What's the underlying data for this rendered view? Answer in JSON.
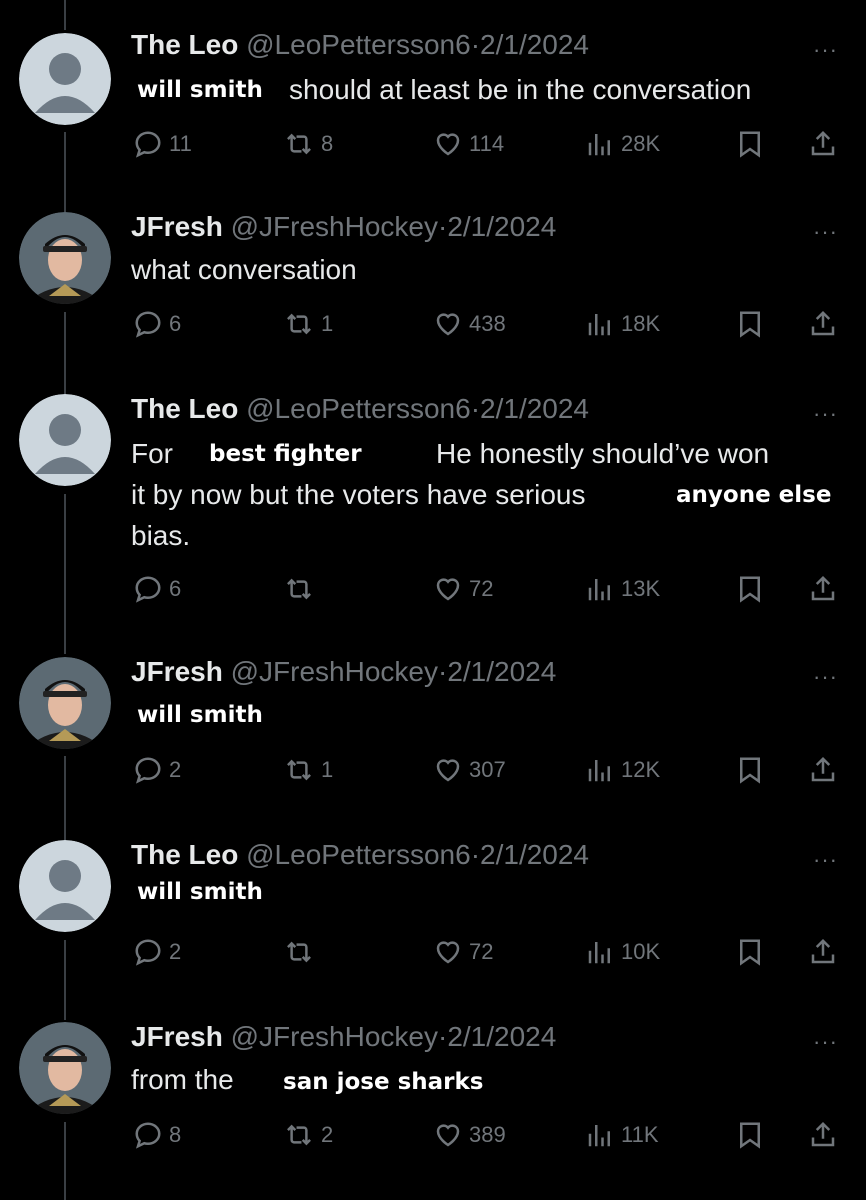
{
  "tweets": [
    {
      "author": "The Leo",
      "handle": "@LeoPettersson6",
      "date": "2/1/2024",
      "text_bold": "will smith",
      "text_rest": "should at least be in the conversation",
      "replies": "11",
      "reposts": "8",
      "likes": "114",
      "views": "28K"
    },
    {
      "author": "JFresh",
      "handle": "@JFreshHockey",
      "date": "2/1/2024",
      "text": "what conversation",
      "replies": "6",
      "reposts": "1",
      "likes": "438",
      "views": "18K"
    },
    {
      "author": "The Leo",
      "handle": "@LeoPettersson6",
      "date": "2/1/2024",
      "text_for": "For",
      "text_bold_1": "best fighter",
      "text_mid": "He honestly should’ve won",
      "text_line2": "it by now but the voters have serious",
      "text_bold_2": "anyone else",
      "text_line3": "bias.",
      "replies": "6",
      "reposts": "",
      "likes": "72",
      "views": "13K"
    },
    {
      "author": "JFresh",
      "handle": "@JFreshHockey",
      "date": "2/1/2024",
      "text_bold": "will smith",
      "replies": "2",
      "reposts": "1",
      "likes": "307",
      "views": "12K"
    },
    {
      "author": "The Leo",
      "handle": "@LeoPettersson6",
      "date": "2/1/2024",
      "text_bold": "will smith",
      "replies": "2",
      "reposts": "",
      "likes": "72",
      "views": "10K"
    },
    {
      "author": "JFresh",
      "handle": "@JFreshHockey",
      "date": "2/1/2024",
      "text_rest": "from the",
      "text_bold": "san jose sharks",
      "replies": "8",
      "reposts": "2",
      "likes": "389",
      "views": "11K"
    }
  ],
  "separator": "·",
  "more_glyph": "···",
  "icons": {
    "reply": "reply-icon",
    "repost": "repost-icon",
    "like": "heart-icon",
    "views": "views-icon",
    "bookmark": "bookmark-icon",
    "share": "share-icon"
  },
  "colors": {
    "background": "#000000",
    "text": "#e7e9ea",
    "muted": "#71767b",
    "thread_line": "#3a3f44"
  }
}
